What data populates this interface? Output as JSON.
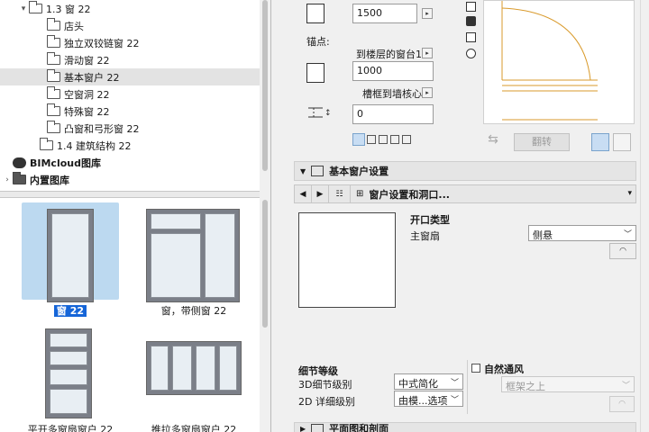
{
  "tree": {
    "items": [
      {
        "label": "1.3 窗 22",
        "level": 1,
        "expanded": true,
        "dark": false
      },
      {
        "label": "店头",
        "level": 2
      },
      {
        "label": "独立双铰链窗 22",
        "level": 2
      },
      {
        "label": "滑动窗 22",
        "level": 2
      },
      {
        "label": "基本窗户 22",
        "level": 2,
        "selected": true
      },
      {
        "label": "空窗洞 22",
        "level": 2
      },
      {
        "label": "特殊窗 22",
        "level": 2
      },
      {
        "label": "凸窗和弓形窗 22",
        "level": 2
      },
      {
        "label": "1.4 建筑结构 22",
        "level": 1
      },
      {
        "label": "BIMcloud图库",
        "level": 0,
        "bold": true
      },
      {
        "label": "内置图库",
        "level": 0,
        "bold": true
      }
    ]
  },
  "gallery": {
    "items": [
      {
        "label": "窗 22",
        "selected": true
      },
      {
        "label": "窗，带侧窗 22"
      },
      {
        "label": "平开多窗扇窗户 22"
      },
      {
        "label": "推拉多窗扇窗户 22"
      }
    ]
  },
  "params": {
    "width_value": "1500",
    "anchor_label": "锚点:",
    "sill_ref": "到楼层的窗台1",
    "sill_value": "1000",
    "reveal_ref": "槽框到墙核心",
    "reveal_value": "0",
    "mirror_label": "翻转"
  },
  "section1": {
    "title": "基本窗户设置"
  },
  "nav": {
    "page_title": "窗户设置和洞口..."
  },
  "opening": {
    "type_heading": "开口类型",
    "main_sash_label": "主窗扇",
    "main_sash_value": "侧悬"
  },
  "detail": {
    "heading": "细节等级",
    "d3_label": "3D细节级别",
    "d3_value": "中式简化",
    "d2_label": "2D 详细级别",
    "d2_value": "由模...选项",
    "vent_label": "自然通风",
    "vent_pos_value": "框架之上"
  },
  "section2": {
    "title": "平面图和剖面"
  }
}
